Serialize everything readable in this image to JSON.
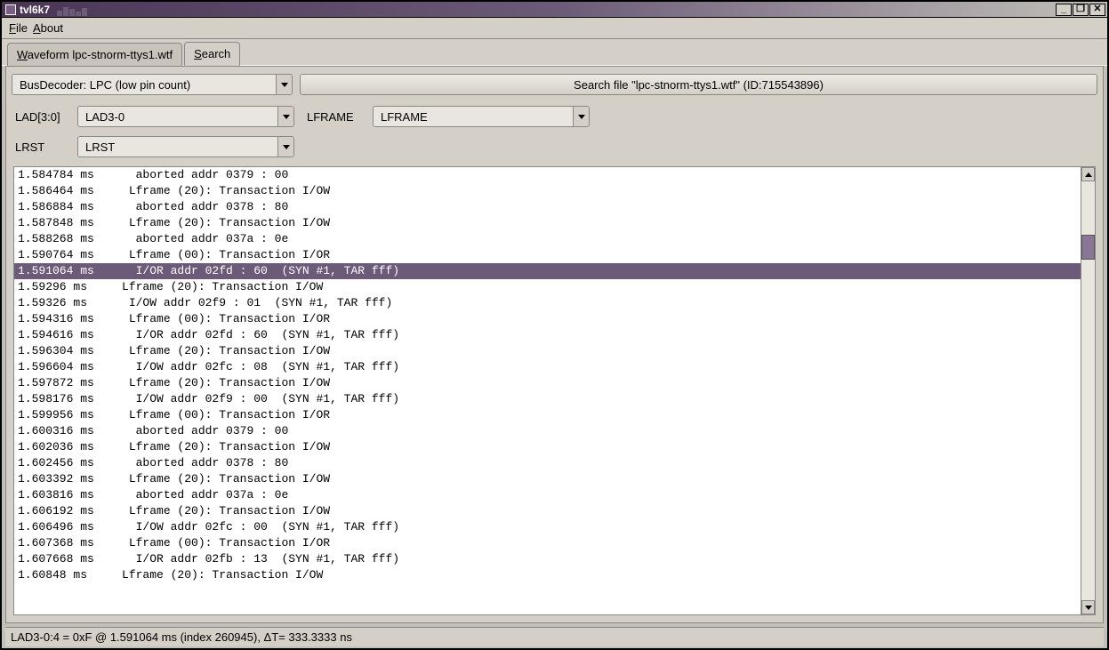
{
  "window": {
    "title": "tvl6k7"
  },
  "titlebar_buttons": {
    "min": "_",
    "max": "❐",
    "close": "✕"
  },
  "menu": {
    "file": "File",
    "about": "About"
  },
  "tabs": {
    "waveform": "Waveform lpc-stnorm-ttys1.wtf",
    "search": "Search",
    "active": "search"
  },
  "toolbar": {
    "decoder": "BusDecoder: LPC (low pin count)",
    "search_button": "Search file \"lpc-stnorm-ttys1.wtf\" (ID:715543896)"
  },
  "params": {
    "lad_label": "LAD[3:0]",
    "lad_value": "LAD3-0",
    "lframe_label": "LFRAME",
    "lframe_value": "LFRAME",
    "lrst_label": "LRST",
    "lrst_value": "LRST"
  },
  "results": {
    "selected_index": 6,
    "rows": [
      "1.584784 ms      aborted addr 0379 : 00",
      "1.586464 ms     Lframe (20): Transaction I/OW",
      "1.586884 ms      aborted addr 0378 : 80",
      "1.587848 ms     Lframe (20): Transaction I/OW",
      "1.588268 ms      aborted addr 037a : 0e",
      "1.590764 ms     Lframe (00): Transaction I/OR",
      "1.591064 ms      I/OR addr 02fd : 60  (SYN #1, TAR fff)",
      "1.59296 ms     Lframe (20): Transaction I/OW",
      "1.59326 ms      I/OW addr 02f9 : 01  (SYN #1, TAR fff)",
      "1.594316 ms     Lframe (00): Transaction I/OR",
      "1.594616 ms      I/OR addr 02fd : 60  (SYN #1, TAR fff)",
      "1.596304 ms     Lframe (20): Transaction I/OW",
      "1.596604 ms      I/OW addr 02fc : 08  (SYN #1, TAR fff)",
      "1.597872 ms     Lframe (20): Transaction I/OW",
      "1.598176 ms      I/OW addr 02f9 : 00  (SYN #1, TAR fff)",
      "1.599956 ms     Lframe (00): Transaction I/OR",
      "1.600316 ms      aborted addr 0379 : 00",
      "1.602036 ms     Lframe (20): Transaction I/OW",
      "1.602456 ms      aborted addr 0378 : 80",
      "1.603392 ms     Lframe (20): Transaction I/OW",
      "1.603816 ms      aborted addr 037a : 0e",
      "1.606192 ms     Lframe (20): Transaction I/OW",
      "1.606496 ms      I/OW addr 02fc : 00  (SYN #1, TAR fff)",
      "1.607368 ms     Lframe (00): Transaction I/OR",
      "1.607668 ms      I/OR addr 02fb : 13  (SYN #1, TAR fff)",
      "1.60848 ms     Lframe (20): Transaction I/OW"
    ]
  },
  "status": "LAD3-0:4 = 0xF @ 1.591064 ms  (index 260945), ΔT= 333.3333 ns"
}
